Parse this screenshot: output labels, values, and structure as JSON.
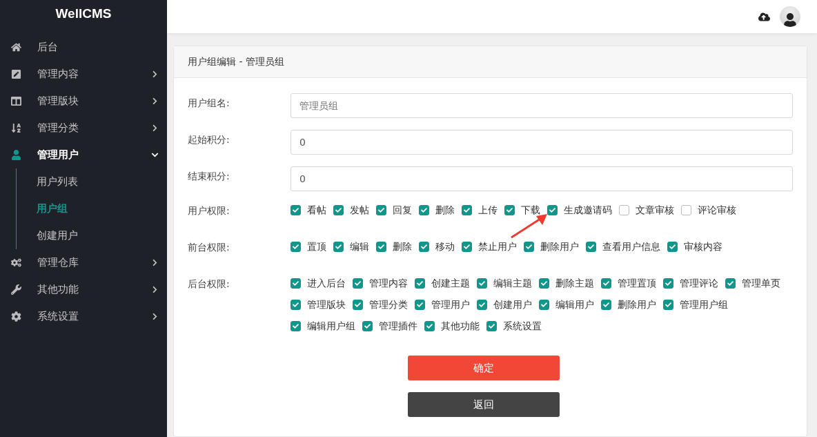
{
  "sidebar": {
    "logo": "WellCMS",
    "items": [
      {
        "label": "后台",
        "has_arrow": false,
        "expanded": false
      },
      {
        "label": "管理内容",
        "has_arrow": true,
        "expanded": false
      },
      {
        "label": "管理版块",
        "has_arrow": true,
        "expanded": false
      },
      {
        "label": "管理分类",
        "has_arrow": true,
        "expanded": false
      },
      {
        "label": "管理用户",
        "has_arrow": true,
        "expanded": true,
        "children": [
          {
            "label": "用户列表",
            "selected": false
          },
          {
            "label": "用户组",
            "selected": true
          },
          {
            "label": "创建用户",
            "selected": false
          }
        ]
      },
      {
        "label": "管理仓库",
        "has_arrow": true,
        "expanded": false
      },
      {
        "label": "其他功能",
        "has_arrow": true,
        "expanded": false
      },
      {
        "label": "系统设置",
        "has_arrow": true,
        "expanded": false
      }
    ]
  },
  "card": {
    "title": "用户组编辑 - 管理员组",
    "fields": [
      {
        "label": "用户组名:",
        "placeholder": "管理员组"
      },
      {
        "label": "起始积分:",
        "value": "0"
      },
      {
        "label": "结束积分:",
        "value": "0"
      }
    ],
    "permission_groups": [
      {
        "label": "用户权限:",
        "items": [
          {
            "label": "看帖",
            "checked": true
          },
          {
            "label": "发帖",
            "checked": true
          },
          {
            "label": "回复",
            "checked": true
          },
          {
            "label": "删除",
            "checked": true
          },
          {
            "label": "上传",
            "checked": true
          },
          {
            "label": "下载",
            "checked": true
          },
          {
            "label": "生成邀请码",
            "checked": true
          },
          {
            "label": "文章审核",
            "checked": false
          },
          {
            "label": "评论审核",
            "checked": false
          }
        ]
      },
      {
        "label": "前台权限:",
        "items": [
          {
            "label": "置顶",
            "checked": true
          },
          {
            "label": "编辑",
            "checked": true
          },
          {
            "label": "删除",
            "checked": true
          },
          {
            "label": "移动",
            "checked": true
          },
          {
            "label": "禁止用户",
            "checked": true
          },
          {
            "label": "删除用户",
            "checked": true
          },
          {
            "label": "查看用户信息",
            "checked": true
          },
          {
            "label": "审核内容",
            "checked": true
          }
        ]
      },
      {
        "label": "后台权限:",
        "items": [
          {
            "label": "进入后台",
            "checked": true
          },
          {
            "label": "管理内容",
            "checked": true
          },
          {
            "label": "创建主题",
            "checked": true
          },
          {
            "label": "编辑主题",
            "checked": true
          },
          {
            "label": "删除主题",
            "checked": true
          },
          {
            "label": "管理置顶",
            "checked": true
          },
          {
            "label": "管理评论",
            "checked": true
          },
          {
            "label": "管理单页",
            "checked": true
          },
          {
            "label": "管理版块",
            "checked": true
          },
          {
            "label": "管理分类",
            "checked": true
          },
          {
            "label": "管理用户",
            "checked": true
          },
          {
            "label": "创建用户",
            "checked": true
          },
          {
            "label": "编辑用户",
            "checked": true
          },
          {
            "label": "删除用户",
            "checked": true
          },
          {
            "label": "管理用户组",
            "checked": true
          },
          {
            "label": "编辑用户组",
            "checked": true
          },
          {
            "label": "管理插件",
            "checked": true
          },
          {
            "label": "其他功能",
            "checked": true
          },
          {
            "label": "系统设置",
            "checked": true
          }
        ]
      }
    ],
    "buttons": [
      {
        "kind": "primary",
        "label": "确定"
      },
      {
        "kind": "secondary",
        "label": "返回"
      }
    ]
  }
}
